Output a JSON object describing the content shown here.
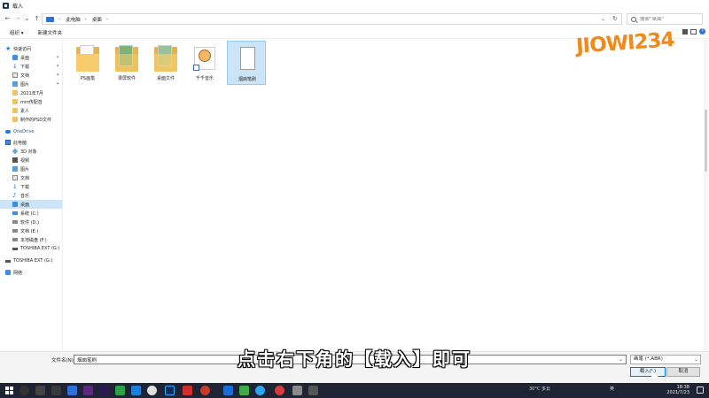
{
  "window": {
    "title": "载入"
  },
  "address": {
    "crumbs": [
      "此电脑",
      "桌面"
    ],
    "search_placeholder": "搜索\"桌面\""
  },
  "toolbar": {
    "organize": "组织 ▾",
    "new_folder": "新建文件夹"
  },
  "nav": {
    "quick_access": "快速访问",
    "items": [
      {
        "label": "桌面",
        "icon": "folder-blue-icon",
        "pinned": true
      },
      {
        "label": "下载",
        "icon": "download-icon",
        "pinned": true
      },
      {
        "label": "文档",
        "icon": "document-icon",
        "pinned": true
      },
      {
        "label": "图片",
        "icon": "picture-icon",
        "pinned": true
      },
      {
        "label": "2021年7月",
        "icon": "folder-icon"
      },
      {
        "label": "mm传配音",
        "icon": "folder-icon"
      },
      {
        "label": "素人",
        "icon": "folder-icon"
      },
      {
        "label": "制作的PSD文件",
        "icon": "folder-icon"
      }
    ],
    "onedrive": "OneDrive",
    "this_pc": "此电脑",
    "pc_items": [
      {
        "label": "3D 对象",
        "icon": "cube-icon"
      },
      {
        "label": "视频",
        "icon": "video-icon"
      },
      {
        "label": "图片",
        "icon": "picture-icon"
      },
      {
        "label": "文档",
        "icon": "document-icon"
      },
      {
        "label": "下载",
        "icon": "download-icon"
      },
      {
        "label": "音乐",
        "icon": "music-icon"
      },
      {
        "label": "桌面",
        "icon": "folder-blue-icon",
        "selected": true
      },
      {
        "label": "系统 (C:)",
        "icon": "windows-drive-icon"
      },
      {
        "label": "软件 (D:)",
        "icon": "drive-icon"
      },
      {
        "label": "文档 (E:)",
        "icon": "drive-icon"
      },
      {
        "label": "本地磁盘 (F:)",
        "icon": "drive-icon"
      },
      {
        "label": "TOSHIBA EXT (G:)",
        "icon": "usb-drive-icon"
      }
    ],
    "external": "TOSHIBA EXT (G:)",
    "network": "网络"
  },
  "files": [
    {
      "name": "PS画笔",
      "type": "folder"
    },
    {
      "name": "录屏软件",
      "type": "folder"
    },
    {
      "name": "桌面文件",
      "type": "folder"
    },
    {
      "name": "千千音乐",
      "type": "shortcut"
    },
    {
      "name": "烟囱笔刷",
      "type": "file",
      "selected": true
    }
  ],
  "watermark": "JIOWI234",
  "bottom": {
    "filename_label": "文件名(N):",
    "filename_value": "烟囱笔刷",
    "filter": "画笔 (*.ABR)",
    "load_button": "载入(L)",
    "cancel_button": "取消"
  },
  "caption": "点击右下角的【载入】即可",
  "taskbar": {
    "weather": "30°C 多云",
    "lang": "英",
    "time": "18:38",
    "date": "2021/7/23"
  },
  "colors": {
    "accent": "#0078d7",
    "selection": "#cce4f7",
    "watermark": "#f08a1c",
    "taskbar": "#1e2433"
  }
}
